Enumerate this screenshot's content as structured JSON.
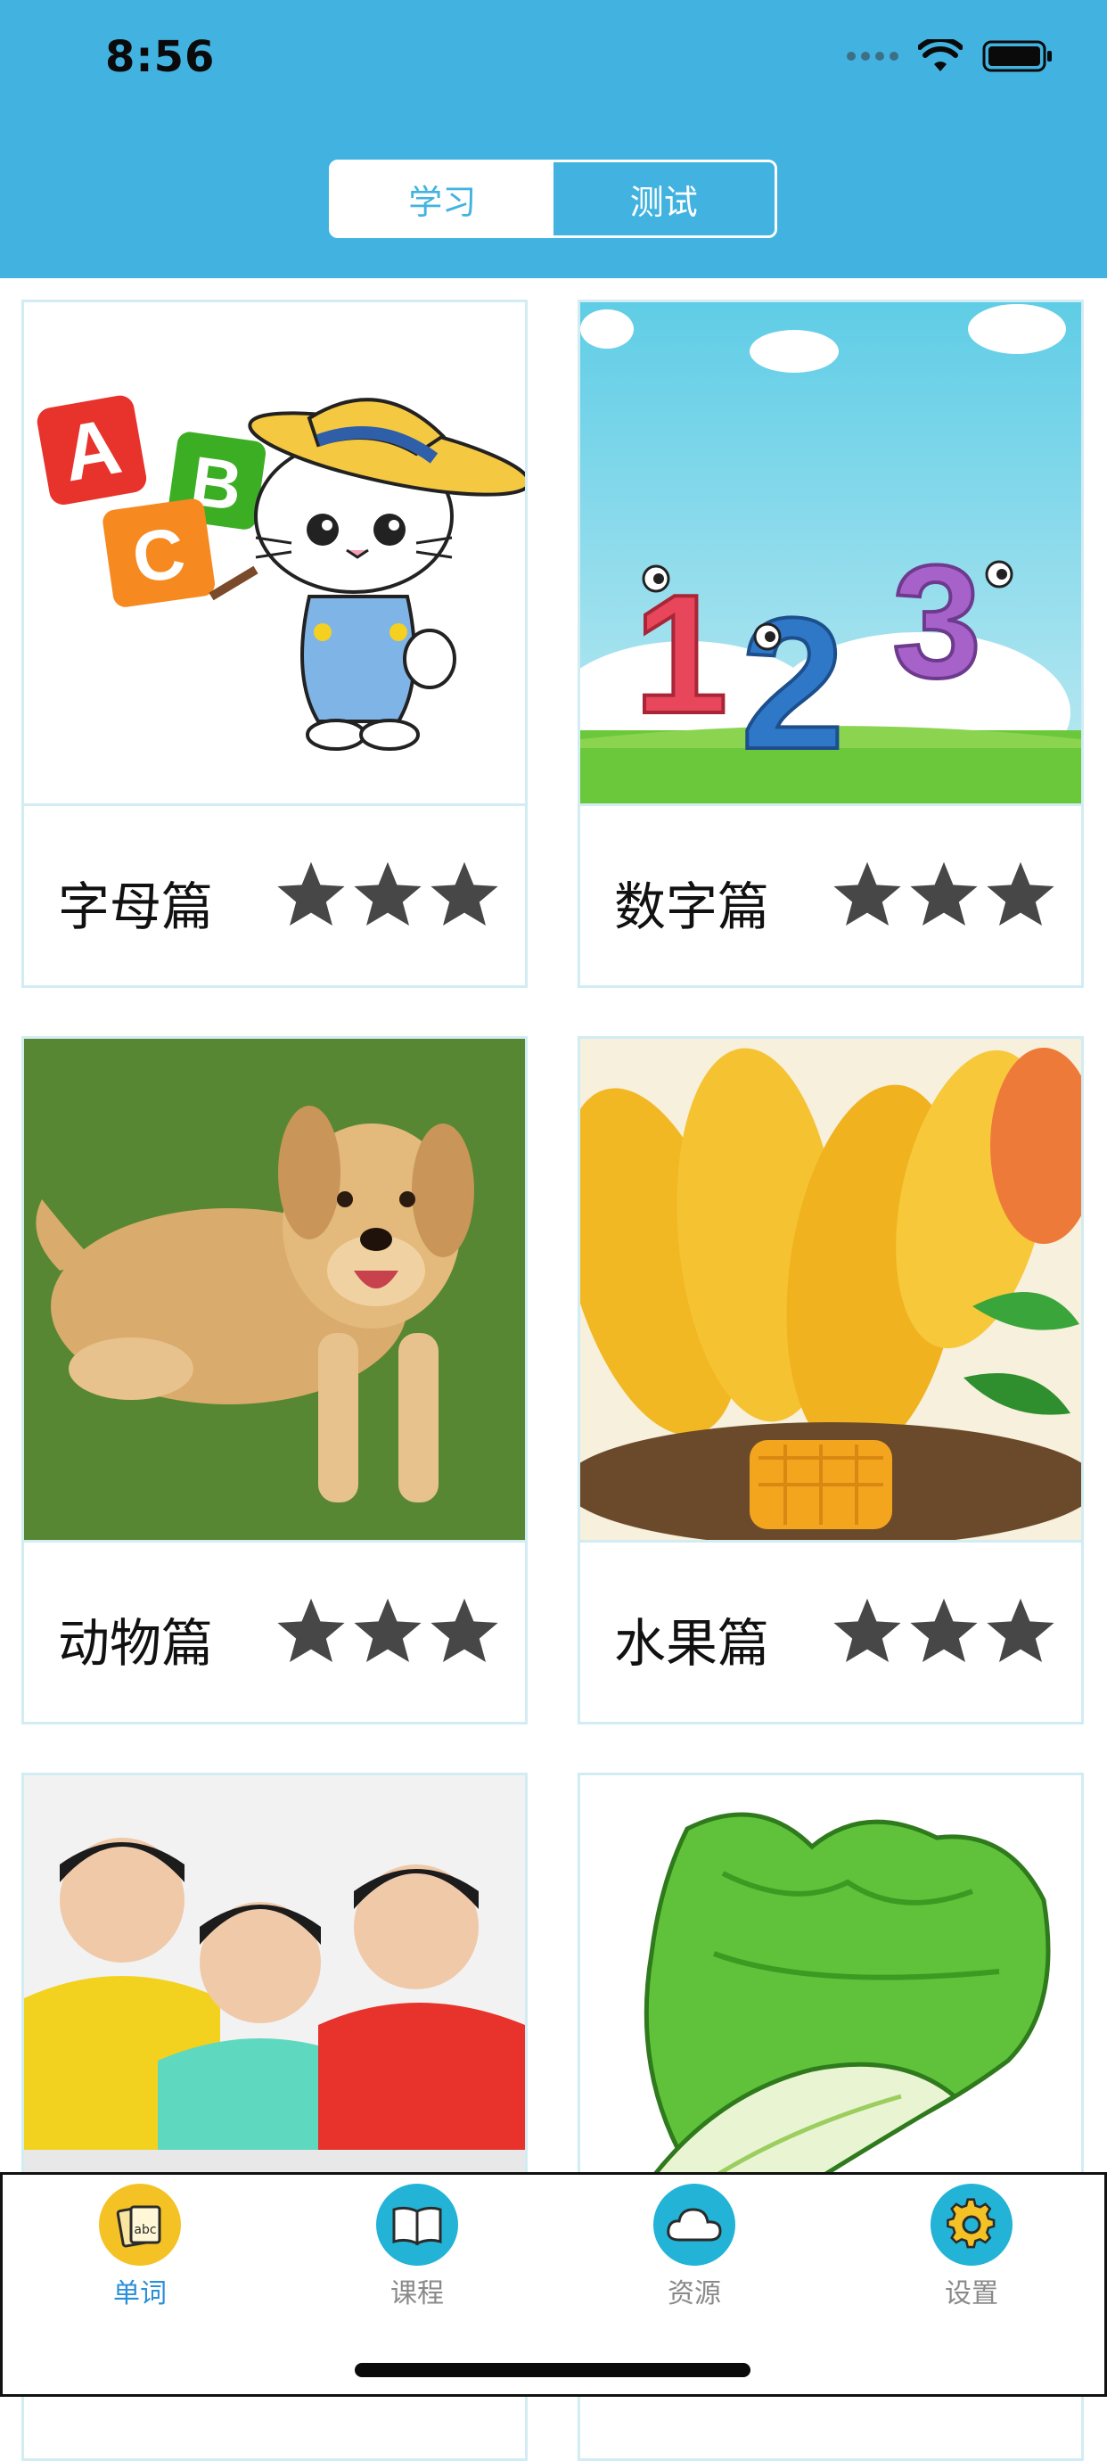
{
  "status_bar": {
    "time": "8:56"
  },
  "segment": {
    "study_label": "学习",
    "test_label": "测试"
  },
  "cards": [
    {
      "title": "字母篇",
      "stars": 3,
      "image": "abc-cat-illustration"
    },
    {
      "title": "数字篇",
      "stars": 3,
      "image": "numbers-123-illustration"
    },
    {
      "title": "动物篇",
      "stars": 3,
      "image": "golden-retriever-photo"
    },
    {
      "title": "水果篇",
      "stars": 3,
      "image": "mango-photo"
    },
    {
      "title": "",
      "stars": 0,
      "image": "three-boys-photo"
    },
    {
      "title": "",
      "stars": 0,
      "image": "cabbage-illustration"
    }
  ],
  "tabbar": {
    "items": [
      {
        "label": "单词",
        "icon": "word-cards-icon",
        "active": true
      },
      {
        "label": "课程",
        "icon": "book-icon",
        "active": false
      },
      {
        "label": "资源",
        "icon": "cloud-icon",
        "active": false
      },
      {
        "label": "设置",
        "icon": "gear-icon",
        "active": false
      }
    ]
  },
  "colors": {
    "header": "#42b3e0",
    "active_tab": "#2a8fd8",
    "inactive_tab": "#8a8a8a",
    "star": "#474747"
  }
}
